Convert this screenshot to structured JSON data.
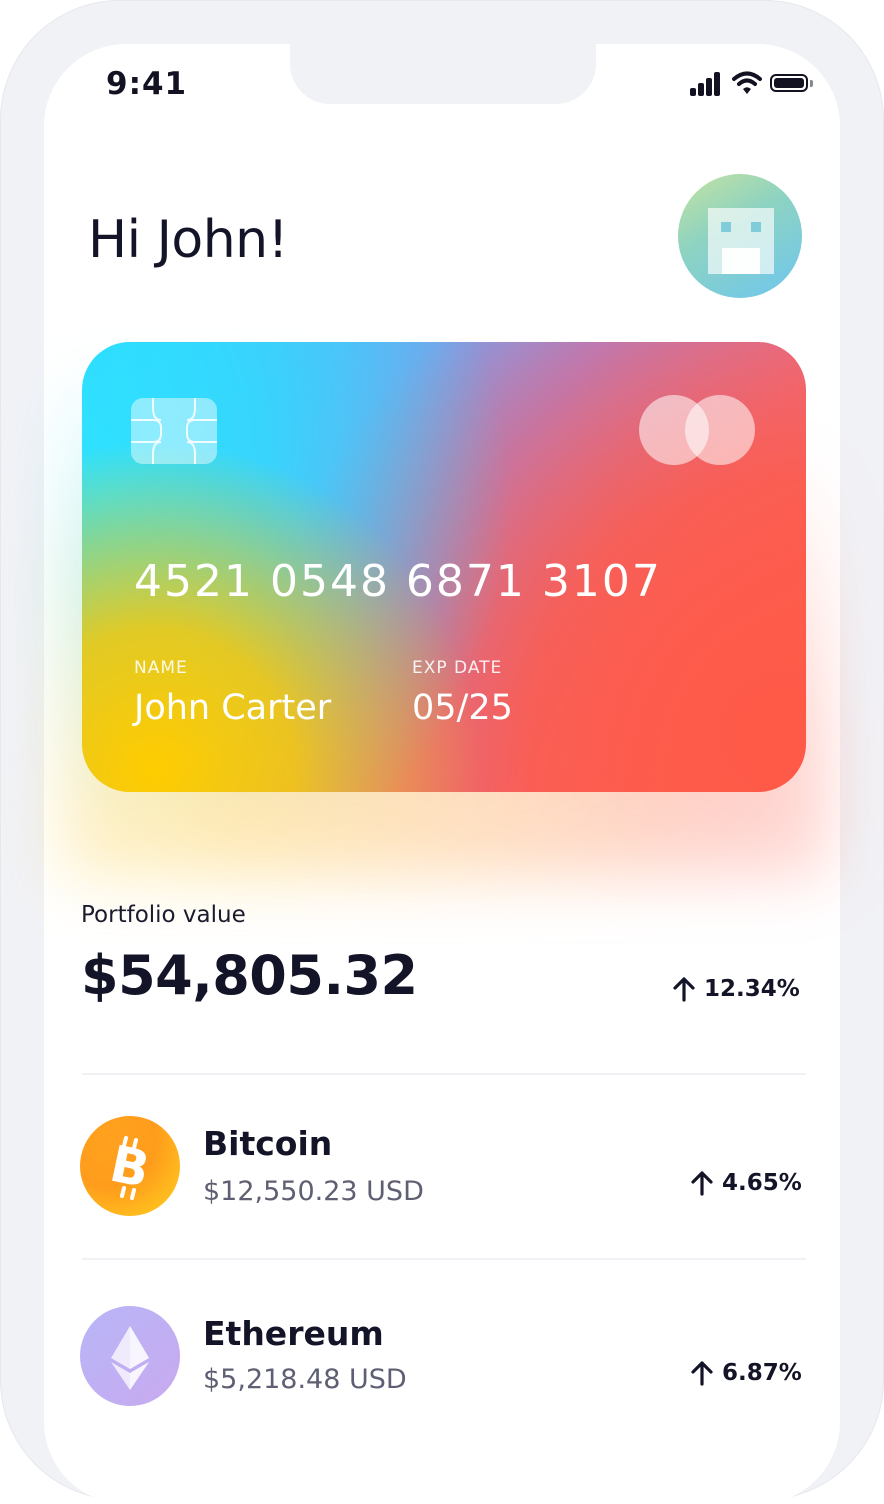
{
  "status_bar": {
    "time": "9:41"
  },
  "header": {
    "greeting": "Hi John!"
  },
  "card": {
    "number": "4521 0548 6871 3107",
    "name_label": "NAME",
    "name_value": "John Carter",
    "exp_label": "EXP DATE",
    "exp_value": "05/25"
  },
  "portfolio": {
    "label": "Portfolio value",
    "value": "$54,805.32",
    "change": "12.34%"
  },
  "assets": [
    {
      "name": "Bitcoin",
      "price": "$12,550.23 USD",
      "change": "4.65%",
      "icon": "bitcoin-icon"
    },
    {
      "name": "Ethereum",
      "price": "$5,218.48 USD",
      "change": "6.87%",
      "icon": "ethereum-icon"
    }
  ],
  "colors": {
    "text_primary": "#141428",
    "text_secondary": "#5e5f72",
    "bitcoin": "#ffa21e",
    "ethereum": "#b7b6f7"
  }
}
